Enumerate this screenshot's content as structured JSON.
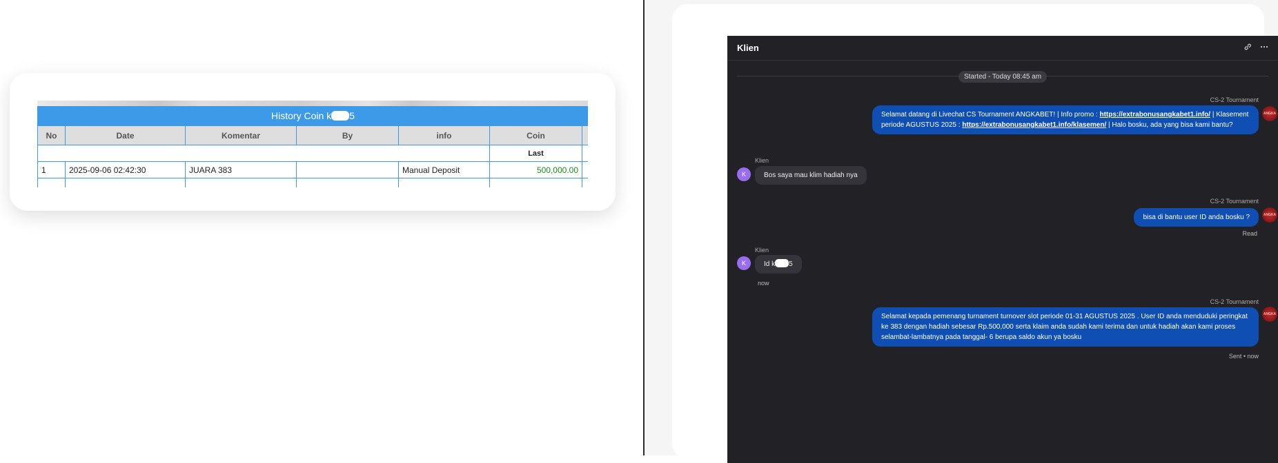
{
  "history": {
    "title_prefix": "History Coin k",
    "title_suffix": "5",
    "columns": [
      "No",
      "Date",
      "Komentar",
      "By",
      "info",
      "Coin"
    ],
    "subheader_last": "Last",
    "rows": [
      {
        "no": "1",
        "date": "2025-09-06 02:42:30",
        "komentar": "JUARA 383",
        "by": "",
        "info": "Manual Deposit",
        "coin": "500,000.00"
      }
    ]
  },
  "chat": {
    "title": "Klien",
    "header_icons": [
      "link-icon",
      "more-icon"
    ],
    "started": "Started - Today 08:45 am",
    "agent_name": "CS-2 Tournament",
    "client_name": "Klien",
    "client_initial": "K",
    "agent_avatar_text": "ANGKA",
    "messages": {
      "m1": {
        "before_link1": "Selamat datang di Livechat CS Tournament ANGKABET! | Info promo : ",
        "link1": "https://extrabonusangkabet1.info/",
        "mid": " | Klasement periode AGUSTUS 2025 : ",
        "link2": "https://extrabonusangkabet1.info/klasemen/",
        "after": " | Halo bosku, ada yang bisa kami bantu?"
      },
      "m2": "Bos saya mau klim hadiah nya",
      "m3": "bisa di bantu user ID anda bosku ?",
      "m3_status": "Read",
      "m4_prefix": "Id k",
      "m4_suffix": "5",
      "m4_time": "now",
      "m5": "Selamat kepada pemenang turnament turnover slot periode 01-31 AGUSTUS 2025 . User ID anda menduduki peringkat ke 383 dengan hadiah sebesar Rp.500,000 serta klaim anda sudah kami terima dan untuk hadiah akan kami proses selambat-lambatnya pada tanggal- 6 berupa saldo akun ya bosku",
      "m5_status": "Sent • now"
    }
  },
  "colors": {
    "table_header_blue": "#3d9ae8",
    "coin_green": "#1a8a1a",
    "chat_bg": "#222226",
    "agent_bubble": "#0f4fb3",
    "client_bubble": "#34343a",
    "client_avatar": "#9a6cf0"
  }
}
